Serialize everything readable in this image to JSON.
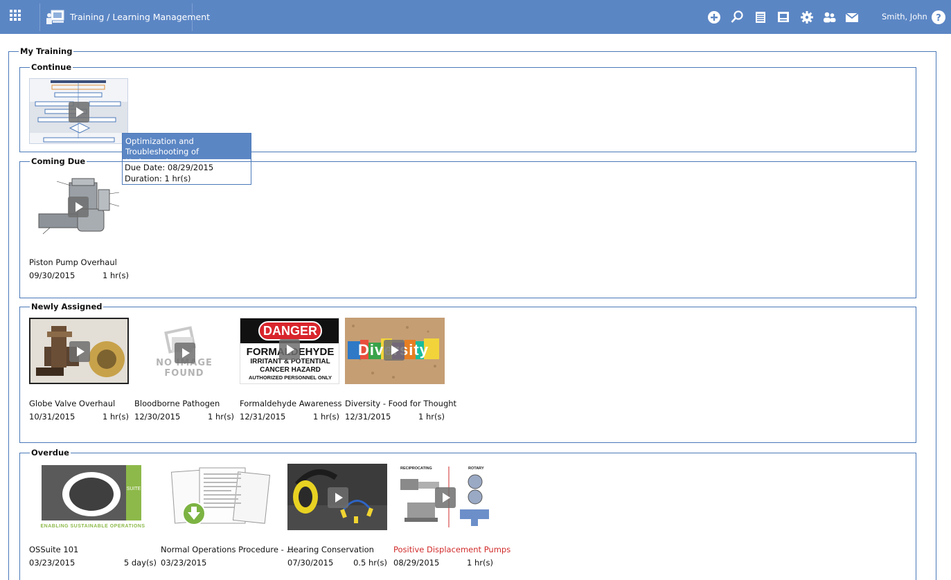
{
  "header": {
    "app_title": "Training / Learning Management",
    "user_name": "Smith, John",
    "icons": [
      "apps-grid-icon",
      "add-icon",
      "search-icon",
      "list-icon",
      "id-card-icon",
      "settings-icon",
      "users-icon",
      "mail-icon",
      "help-icon"
    ]
  },
  "page": {
    "title": "My Training"
  },
  "sections": {
    "continue": {
      "label": "Continue",
      "items": [
        {
          "title": "Optimization and Troubleshooting of Hydrocracker"
        }
      ]
    },
    "coming_due": {
      "label": "Coming Due",
      "items": [
        {
          "title": "Piston Pump Overhaul",
          "date": "09/30/2015",
          "duration": "1 hr(s)"
        }
      ]
    },
    "newly_assigned": {
      "label": "Newly Assigned",
      "items": [
        {
          "title": "Globe Valve Overhaul",
          "date": "10/31/2015",
          "duration": "1 hr(s)"
        },
        {
          "title": "Bloodborne Pathogen",
          "date": "12/30/2015",
          "duration": "1 hr(s)",
          "thumb_text": "NO IMAGE FOUND"
        },
        {
          "title": "Formaldehyde Awareness",
          "date": "12/31/2015",
          "duration": "1 hr(s)",
          "thumb_lines": [
            "DANGER",
            "FORMALDEHYDE",
            "IRRITANT & POTENTIAL",
            "CANCER HAZARD",
            "AUTHORIZED PERSONNEL ONLY"
          ]
        },
        {
          "title": "Diversity - Food for Thought",
          "date": "12/31/2015",
          "duration": "1 hr(s)",
          "thumb_text": "Diversity"
        }
      ]
    },
    "overdue": {
      "label": "Overdue",
      "items": [
        {
          "title": "OSSuite 101",
          "date": "03/23/2015",
          "duration": "5 day(s)",
          "thumb_text": "ENABLING SUSTAINABLE OPERATIONS",
          "thumb_side_text": "SUITE"
        },
        {
          "title": "Normal Operations Procedure - ...",
          "date": "03/23/2015",
          "duration": ""
        },
        {
          "title": "Hearing Conservation",
          "date": "07/30/2015",
          "duration": "0.5 hr(s)"
        },
        {
          "title": "Positive Displacement Pumps",
          "date": "08/29/2015",
          "duration": "1 hr(s)",
          "thumb_labels": [
            "RECIPROCATING",
            "ROTARY"
          ]
        }
      ]
    }
  },
  "tooltip": {
    "title": "Optimization and Troubleshooting of Hydrocracker",
    "due_date": "Due Date: 08/29/2015",
    "duration": "Duration: 1 hr(s)"
  },
  "colors": {
    "header_bg": "#5b86c4",
    "border": "#4a78b8",
    "overdue_highlight": "#d12a2a"
  }
}
